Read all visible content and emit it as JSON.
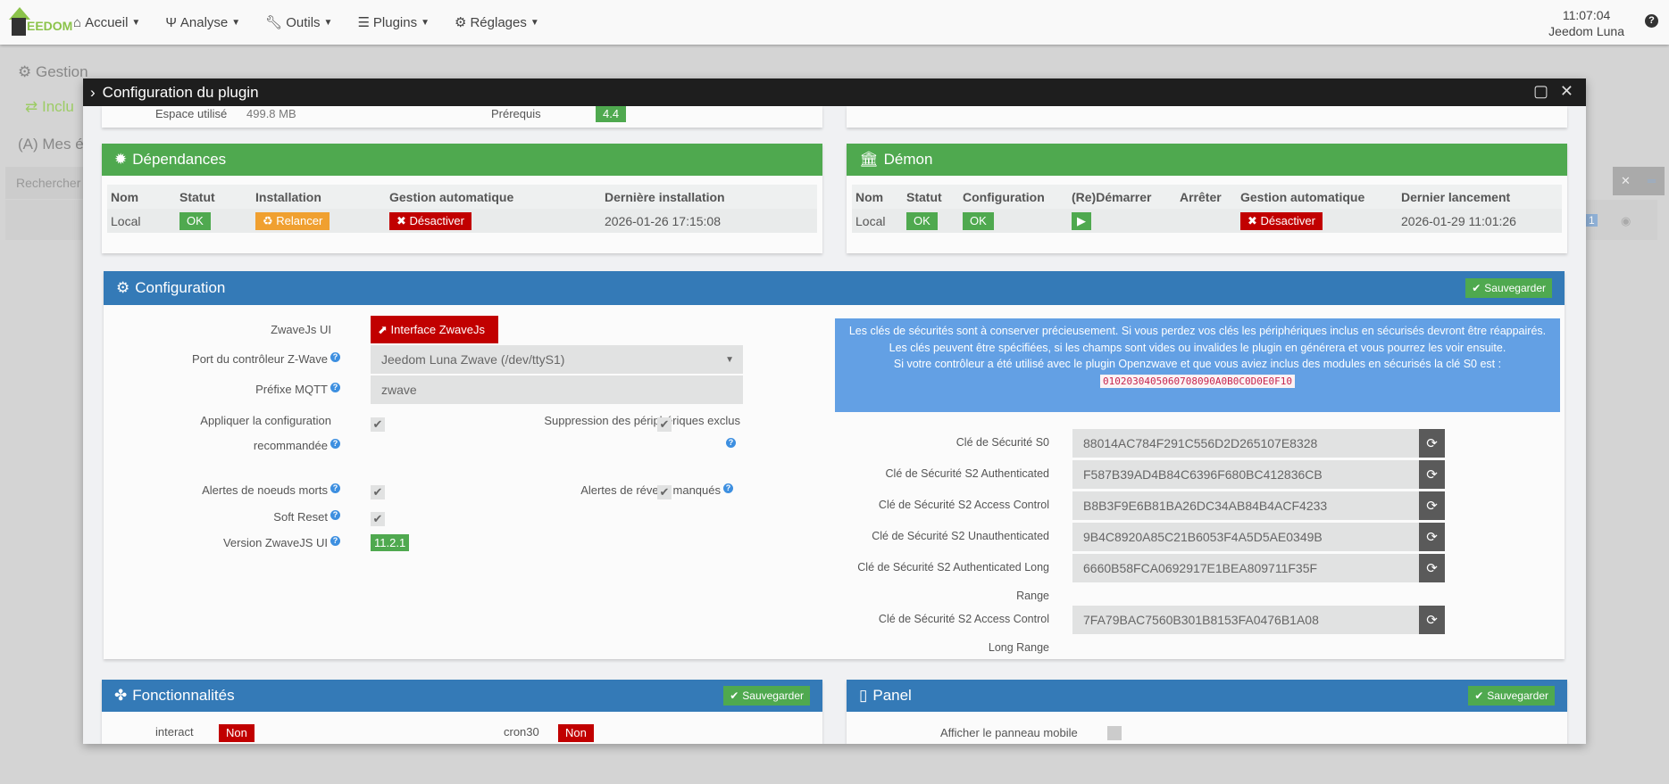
{
  "navbar": {
    "logo_text": "EEDOM",
    "items": [
      {
        "label": "Accueil",
        "icon": "home-icon"
      },
      {
        "label": "Analyse",
        "icon": "stethoscope-icon"
      },
      {
        "label": "Outils",
        "icon": "wrench-icon"
      },
      {
        "label": "Plugins",
        "icon": "list-icon"
      },
      {
        "label": "Réglages",
        "icon": "gear-icon"
      }
    ],
    "time": "11:07:04",
    "box_name": "Jeedom Luna",
    "help": "?"
  },
  "background": {
    "gestion": "Gestion",
    "inclusion": "Inclu",
    "mes": "Mes é",
    "search_placeholder": "Rechercher",
    "badge": "1"
  },
  "modal": {
    "title": "Configuration du plugin",
    "info": {
      "space_label": "Espace utilisé",
      "space_value": "499.8 MB",
      "prereq_label": "Prérequis",
      "prereq_value": "4.4"
    },
    "dependencies": {
      "title": "Dépendances",
      "headers": [
        "Nom",
        "Statut",
        "Installation",
        "Gestion automatique",
        "Dernière installation"
      ],
      "row": {
        "name": "Local",
        "status": "OK",
        "install": "Relancer",
        "auto": "Désactiver",
        "last": "2026-01-26 17:15:08"
      }
    },
    "daemon": {
      "title": "Démon",
      "headers": [
        "Nom",
        "Statut",
        "Configuration",
        "(Re)Démarrer",
        "Arrêter",
        "Gestion automatique",
        "Dernier lancement"
      ],
      "row": {
        "name": "Local",
        "status": "OK",
        "config": "OK",
        "auto": "Désactiver",
        "last": "2026-01-29 11:01:26"
      }
    },
    "configuration": {
      "title": "Configuration",
      "save": "Sauvegarder",
      "zwavejs_label": "ZwaveJs UI",
      "zwavejs_button": "Interface ZwaveJs UI",
      "port_label": "Port du contrôleur Z-Wave",
      "port_value": "Jeedom Luna Zwave (/dev/ttyS1)",
      "mqtt_label": "Préfixe MQTT",
      "mqtt_value": "zwave",
      "apply_label_1": "Appliquer la configuration",
      "apply_label_2": "recommandée",
      "apply_checked": true,
      "remove_label": "Suppression des périphériques exclus",
      "remove_checked": true,
      "dead_label": "Alertes de noeuds morts",
      "dead_checked": true,
      "wake_label": "Alertes de réveils manqués",
      "wake_checked": true,
      "soft_label": "Soft Reset",
      "soft_checked": true,
      "version_label": "Version ZwaveJS UI",
      "version_value": "11.2.1",
      "alert_text": "Les clés de sécurités sont à conserver précieusement. Si vous perdez vos clés les périphériques inclus en sécurisés devront être réappairés. Les clés peuvent être spécifiées, si les champs sont vides ou invalides le plugin en générera et vous pourrez les voir ensuite.",
      "alert_text_2": "Si votre contrôleur a été utilisé avec le plugin Openzwave et que vous aviez inclus des modules en sécurisés la clé S0 est :",
      "alert_code": "0102030405060708090A0B0C0D0E0F10",
      "keys": [
        {
          "label": "Clé de Sécurité S0",
          "value": "88014AC784F291C556D2D265107E8328"
        },
        {
          "label": "Clé de Sécurité S2 Authenticated",
          "value": "F587B39AD4B84C6396F680BC412836CB"
        },
        {
          "label": "Clé de Sécurité S2 Access Control",
          "value": "B8B3F9E6B81BA26DC34AB84B4ACF4233"
        },
        {
          "label": "Clé de Sécurité S2 Unauthenticated",
          "value": "9B4C8920A85C21B6053F4A5D5AE0349B"
        },
        {
          "label": "Clé de Sécurité S2 Authenticated Long",
          "label2": "Range",
          "value": "6660B58FCA0692917E1BEA809711F35F"
        },
        {
          "label": "Clé de Sécurité S2 Access Control",
          "label2": "Long Range",
          "value": "7FA79BAC7560B301B8153FA0476B1A08"
        }
      ]
    },
    "features": {
      "title": "Fonctionnalités",
      "save": "Sauvegarder",
      "interact": "interact",
      "interact_value": "Non",
      "cron": "cron30",
      "cron_value": "Non"
    },
    "panel": {
      "title": "Panel",
      "save": "Sauvegarder",
      "mobile_label": "Afficher le panneau mobile"
    }
  },
  "colors": {
    "green": "#4fa94f",
    "blue": "#347ab7",
    "red": "#c10000",
    "orange": "#f0a030",
    "alert": "#63a0e4"
  }
}
